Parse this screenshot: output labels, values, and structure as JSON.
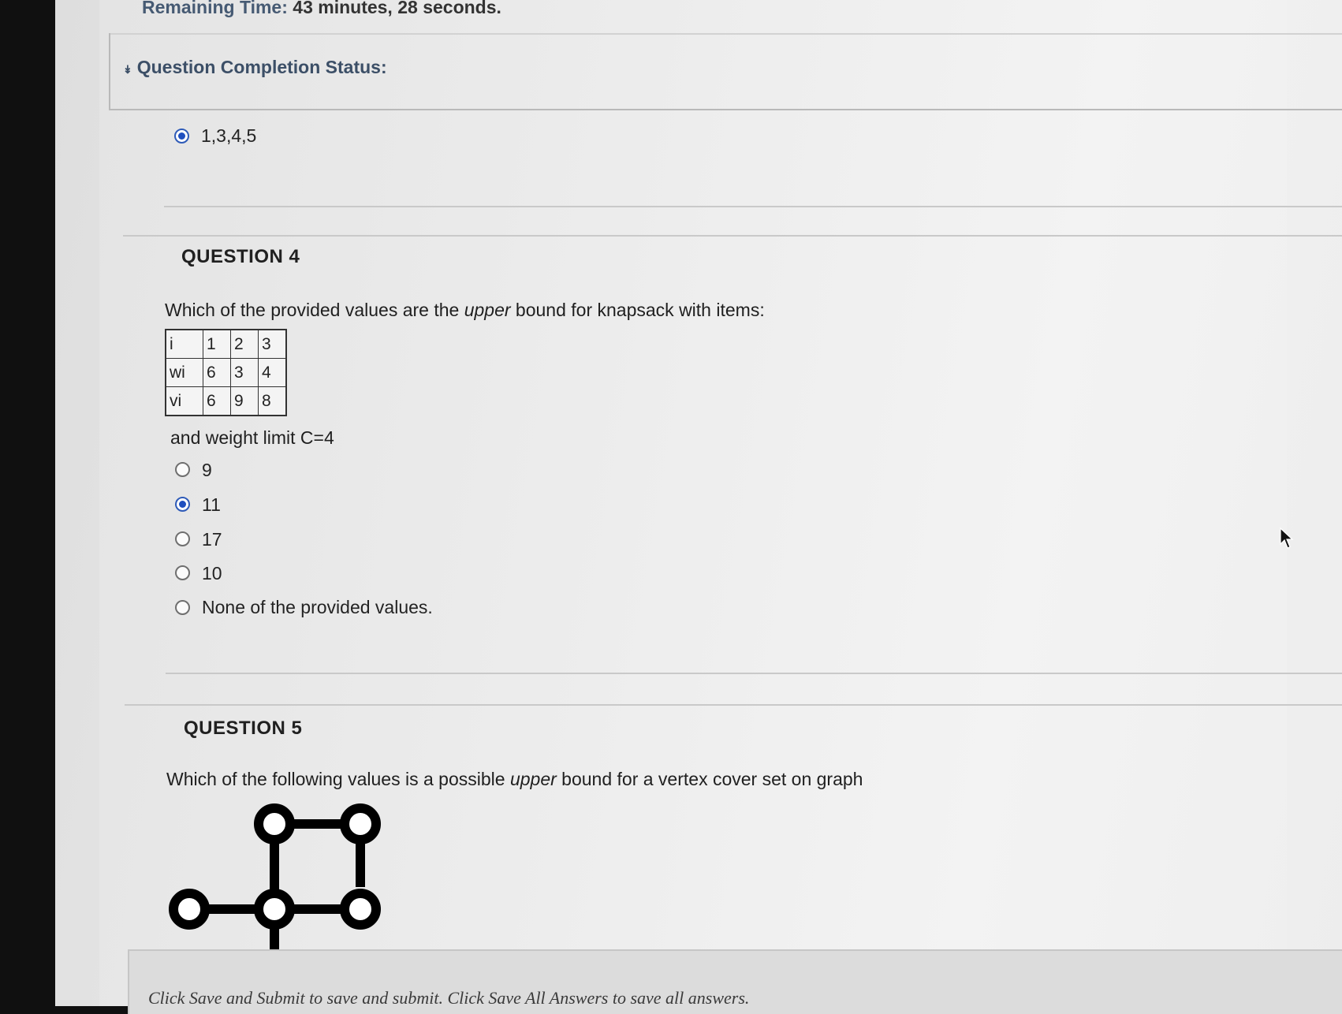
{
  "timer": {
    "label": "Remaining Time:",
    "value": "43 minutes, 28 seconds."
  },
  "status": {
    "chevron_icon": "double-chevron-down-icon",
    "title": "Question Completion Status:"
  },
  "question3": {
    "selected_option": "1,3,4,5"
  },
  "question4": {
    "title": "QUESTION 4",
    "prompt_before": "Which of the provided values are the ",
    "prompt_emphasis": "upper",
    "prompt_after": " bound for knapsack with items:",
    "table": {
      "rows": [
        [
          "i",
          "1",
          "2",
          "3"
        ],
        [
          "wi",
          "6",
          "3",
          "4"
        ],
        [
          "vi",
          "6",
          "9",
          "8"
        ]
      ]
    },
    "constraint": "and weight limit C=4",
    "options": [
      {
        "label": "9",
        "selected": false
      },
      {
        "label": "11",
        "selected": true
      },
      {
        "label": "17",
        "selected": false
      },
      {
        "label": "10",
        "selected": false
      },
      {
        "label": "None of the provided values.",
        "selected": false
      }
    ]
  },
  "question5": {
    "title": "QUESTION 5",
    "prompt_before": "Which of the following values is a possible ",
    "prompt_emphasis": "upper",
    "prompt_after": " bound for a vertex cover set on graph"
  },
  "footer": {
    "text": "Click Save and Submit to save and submit. Click Save All Answers to save all answers."
  },
  "colors": {
    "accent": "#1f4fbf",
    "status_title": "#3c4f67"
  }
}
